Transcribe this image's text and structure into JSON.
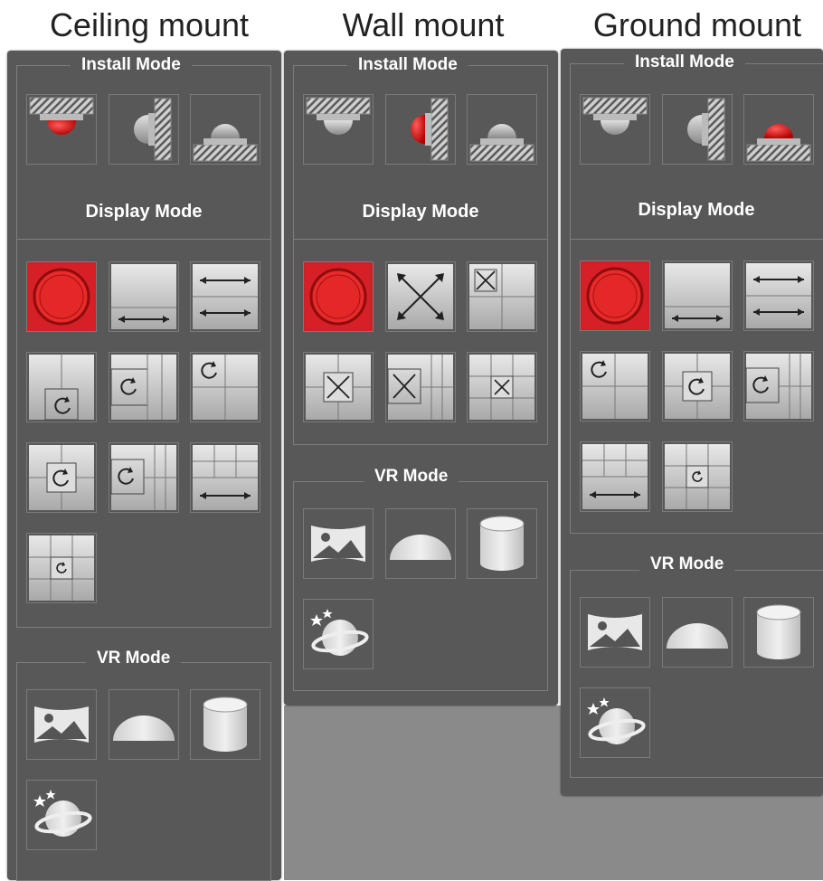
{
  "columns": [
    {
      "title": "Ceiling mount",
      "install_label": "Install Mode",
      "display_label": "Display Mode",
      "vr_label": "VR Mode"
    },
    {
      "title": "Wall mount",
      "install_label": "Install Mode",
      "display_label": "Display Mode",
      "vr_label": "VR Mode"
    },
    {
      "title": "Ground mount",
      "install_label": "Install Mode",
      "display_label": "Display Mode",
      "vr_label": "VR Mode"
    }
  ],
  "colors": {
    "panel": "#585858",
    "border": "#7d7d7d",
    "active_red": "#d21f26",
    "tile_light": "#e6e6e6",
    "tile_dark": "#a8a8a8"
  },
  "icons": {
    "install": [
      "ceiling-mount-icon",
      "wall-mount-icon",
      "ground-mount-icon"
    ],
    "ceiling_display": [
      "fisheye-original-icon",
      "panorama-icon",
      "double-panorama-icon",
      "1p-plus-3r-icon",
      "2p-plus-r-icon",
      "4r-icon",
      "1o-plus-3r-icon",
      "1p-plus-6r-icon",
      "panorama-plus-6r-icon",
      "1o-plus-8r-icon"
    ],
    "wall_display": [
      "fisheye-original-icon",
      "expand-panorama-icon",
      "1e-plus-3r-icon",
      "1e-plus-3r-alt-icon",
      "1e-plus-6r-icon",
      "1e-plus-8r-icon"
    ],
    "ground_display": [
      "fisheye-original-icon",
      "panorama-icon",
      "double-panorama-icon",
      "4r-icon",
      "1o-plus-3r-icon",
      "1p-plus-6r-icon",
      "panorama-plus-6r-icon",
      "1o-plus-8r-icon"
    ],
    "vr": [
      "vr-panorama-icon",
      "vr-hemisphere-icon",
      "vr-cylinder-icon",
      "vr-planet-icon"
    ]
  },
  "state": {
    "ceiling_install_selected": 0,
    "wall_install_selected": 1,
    "ground_install_selected": 2,
    "display_selected": 0
  }
}
